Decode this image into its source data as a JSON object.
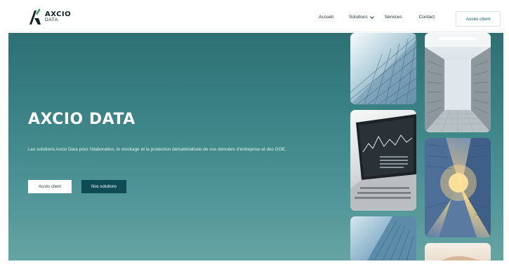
{
  "brand": {
    "name": "AXCIO",
    "sub": "DATA",
    "colors": {
      "primary": "#0f4b55",
      "accent": "#2e7074",
      "logo_green": "#2c9a5b"
    }
  },
  "nav": {
    "items": [
      {
        "label": "Accueil"
      },
      {
        "label": "Solutions",
        "icon": "chevron-down-icon"
      },
      {
        "label": "Services"
      },
      {
        "label": "Contact"
      }
    ],
    "cta_label": "Accès client"
  },
  "hero": {
    "title": "AXCIO DATA",
    "description": "Les solutions Axcio Data pour l'élaboration, le stockage et la protection dématérialisée de vos données d'entreprise et des DOE.",
    "buttons": {
      "client": "Accès client",
      "solutions": "Nos solutions"
    }
  },
  "gallery": {
    "images": [
      {
        "name": "glass-building-photo"
      },
      {
        "name": "server-room-photo"
      },
      {
        "name": "laptop-chart-photo"
      },
      {
        "name": "skyscrapers-sunlight-photo"
      },
      {
        "name": "office-tower-photo"
      },
      {
        "name": "handshake-photo"
      }
    ]
  }
}
